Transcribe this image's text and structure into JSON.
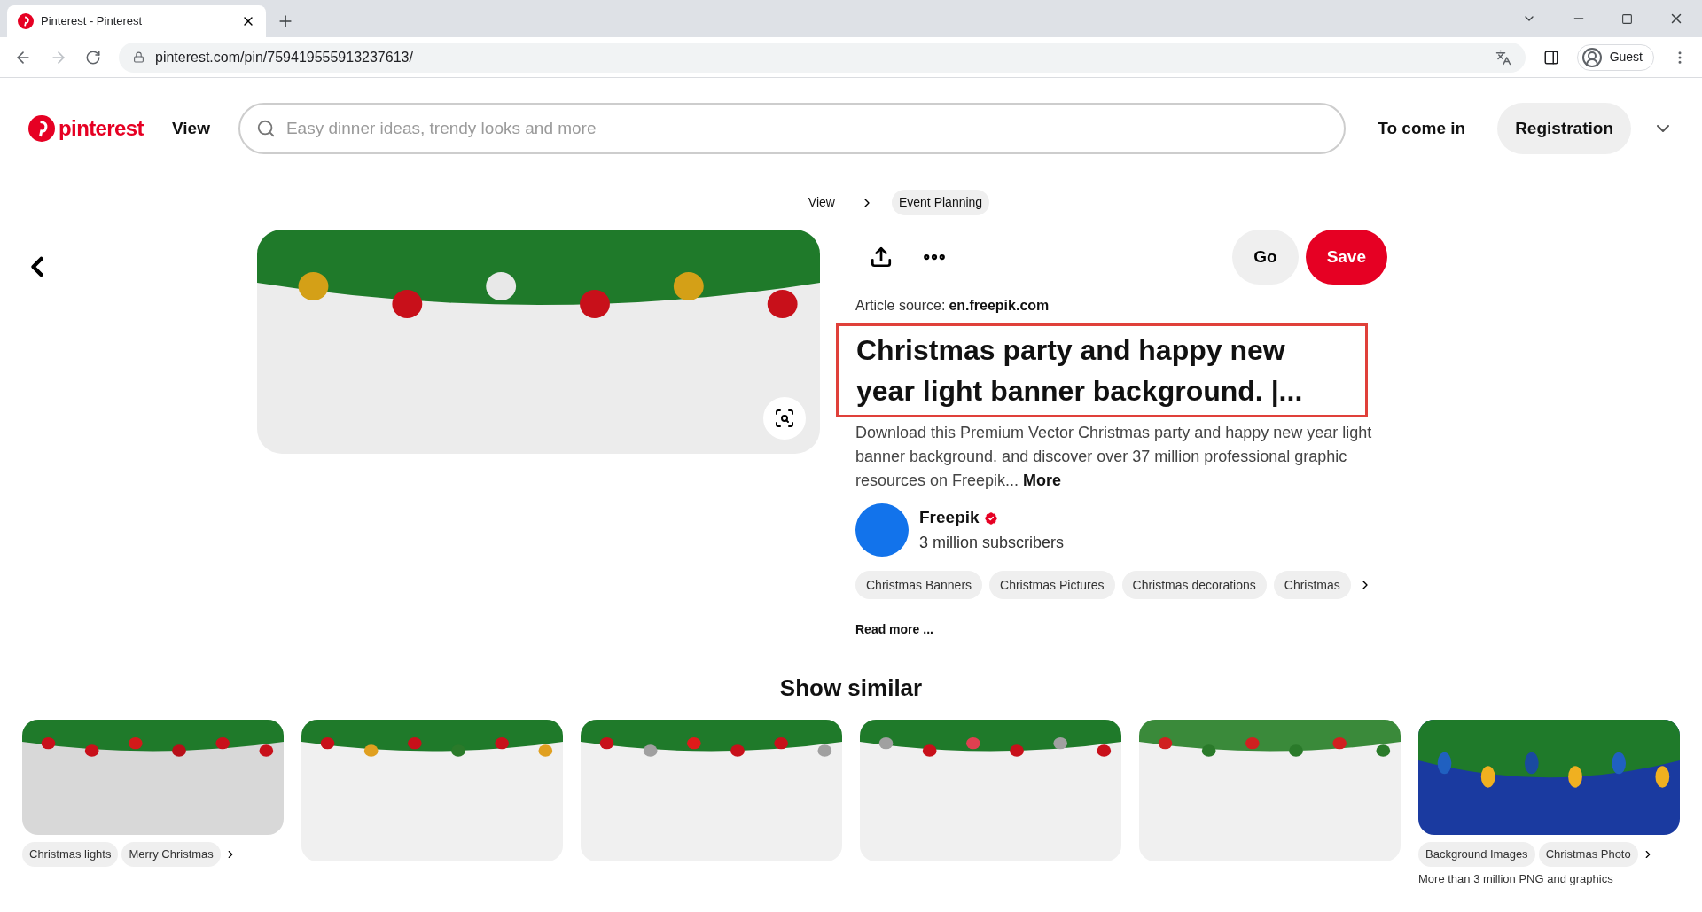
{
  "browser": {
    "tab_title": "Pinterest - Pinterest",
    "url": "pinterest.com/pin/759419555913237613/",
    "profile": "Guest"
  },
  "header": {
    "logo": "pinterest",
    "nav": "View",
    "search": {
      "placeholder": "Easy dinner ideas, trendy looks and more"
    },
    "login": "To come in",
    "register": "Registration"
  },
  "breadcrumb": [
    "View",
    "Event Planning"
  ],
  "pin": {
    "go": "Go",
    "save": "Save",
    "source_label": "Article source:",
    "source": "en.freepik.com",
    "title": "Christmas party and happy new year light banner background. |...",
    "description": "Download this Premium Vector Christmas party and happy new year light banner background. and discover over 37 million professional graphic resources on Freepik...",
    "more": "More",
    "author": {
      "name": "Freepik",
      "verified": true,
      "subscribers": "3 million subscribers"
    },
    "tags": [
      "Christmas Banners",
      "Christmas Pictures",
      "Christmas decorations",
      "Christmas"
    ],
    "read_more": "Read more ..."
  },
  "similar": {
    "title": "Show similar",
    "cards": [
      {
        "kind": "balls",
        "tags": [
          "Christmas lights",
          "Merry Christmas"
        ]
      },
      {
        "kind": "garland"
      },
      {
        "kind": "bow"
      },
      {
        "kind": "checker"
      },
      {
        "kind": "ribbon"
      },
      {
        "kind": "blue",
        "tags": [
          "Background Images",
          "Christmas Photo"
        ],
        "caption": "More than 3 million PNG and graphics"
      }
    ]
  }
}
